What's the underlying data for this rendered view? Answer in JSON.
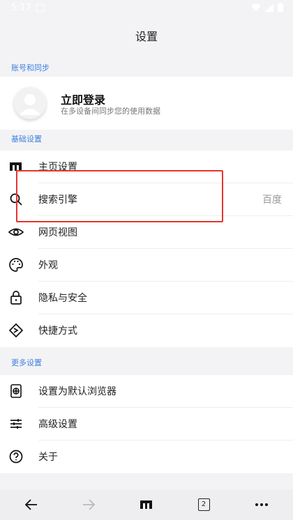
{
  "status_bar": {
    "time": "5:17"
  },
  "header": {
    "title": "设置"
  },
  "account_section": {
    "title": "账号和同步",
    "login_title": "立即登录",
    "login_subtitle": "在多设备间同步您的使用数据"
  },
  "basic_section": {
    "title": "基础设置",
    "items": [
      {
        "label": "主页设置",
        "icon": "home-logo-icon"
      },
      {
        "label": "搜索引擎",
        "value": "百度",
        "icon": "search-icon"
      },
      {
        "label": "网页视图",
        "icon": "eye-icon"
      },
      {
        "label": "外观",
        "icon": "palette-icon"
      },
      {
        "label": "隐私与安全",
        "icon": "lock-icon"
      },
      {
        "label": "快捷方式",
        "icon": "shortcut-icon"
      }
    ]
  },
  "more_section": {
    "title": "更多设置",
    "items": [
      {
        "label": "设置为默认浏览器",
        "icon": "browser-globe-icon"
      },
      {
        "label": "高级设置",
        "icon": "sliders-icon"
      },
      {
        "label": "关于",
        "icon": "help-icon"
      }
    ]
  },
  "bottom_bar": {
    "tab_count": "2"
  },
  "colors": {
    "accent": "#3f7fe0",
    "highlight": "#e5342c",
    "background": "#f3f3f5"
  }
}
